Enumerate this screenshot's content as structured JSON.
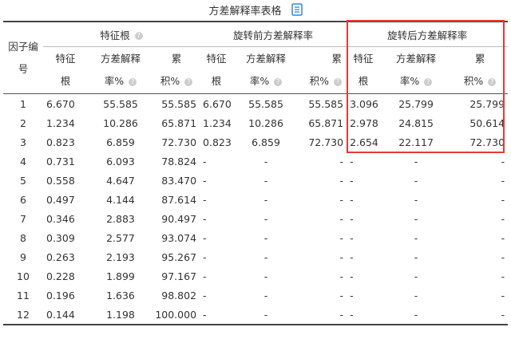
{
  "title": "方差解释率表格",
  "icons": {
    "doc": "document-icon",
    "help": "question-circle-icon"
  },
  "colors": {
    "highlight": "#e53935",
    "icon_blue": "#2e86de"
  },
  "headers": {
    "index": "因子编号",
    "group1": "特征根",
    "group2": "旋转前方差解释率",
    "group3": "旋转后方差解释率",
    "sub_eigen": "特征根",
    "sub_var": "方差解释率%",
    "sub_cum": "累积%"
  },
  "rows": [
    {
      "id": "1",
      "e1": "6.670",
      "v1": "55.585",
      "c1": "55.585",
      "e2": "6.670",
      "v2": "55.585",
      "c2": "55.585",
      "e3": "3.096",
      "v3": "25.799",
      "c3": "25.799"
    },
    {
      "id": "2",
      "e1": "1.234",
      "v1": "10.286",
      "c1": "65.871",
      "e2": "1.234",
      "v2": "10.286",
      "c2": "65.871",
      "e3": "2.978",
      "v3": "24.815",
      "c3": "50.614"
    },
    {
      "id": "3",
      "e1": "0.823",
      "v1": "6.859",
      "c1": "72.730",
      "e2": "0.823",
      "v2": "6.859",
      "c2": "72.730",
      "e3": "2.654",
      "v3": "22.117",
      "c3": "72.730"
    },
    {
      "id": "4",
      "e1": "0.731",
      "v1": "6.093",
      "c1": "78.824",
      "e2": "-",
      "v2": "-",
      "c2": "-",
      "e3": "-",
      "v3": "-",
      "c3": "-"
    },
    {
      "id": "5",
      "e1": "0.558",
      "v1": "4.647",
      "c1": "83.470",
      "e2": "-",
      "v2": "-",
      "c2": "-",
      "e3": "-",
      "v3": "-",
      "c3": "-"
    },
    {
      "id": "6",
      "e1": "0.497",
      "v1": "4.144",
      "c1": "87.614",
      "e2": "-",
      "v2": "-",
      "c2": "-",
      "e3": "-",
      "v3": "-",
      "c3": "-"
    },
    {
      "id": "7",
      "e1": "0.346",
      "v1": "2.883",
      "c1": "90.497",
      "e2": "-",
      "v2": "-",
      "c2": "-",
      "e3": "-",
      "v3": "-",
      "c3": "-"
    },
    {
      "id": "8",
      "e1": "0.309",
      "v1": "2.577",
      "c1": "93.074",
      "e2": "-",
      "v2": "-",
      "c2": "-",
      "e3": "-",
      "v3": "-",
      "c3": "-"
    },
    {
      "id": "9",
      "e1": "0.263",
      "v1": "2.193",
      "c1": "95.267",
      "e2": "-",
      "v2": "-",
      "c2": "-",
      "e3": "-",
      "v3": "-",
      "c3": "-"
    },
    {
      "id": "10",
      "e1": "0.228",
      "v1": "1.899",
      "c1": "97.167",
      "e2": "-",
      "v2": "-",
      "c2": "-",
      "e3": "-",
      "v3": "-",
      "c3": "-"
    },
    {
      "id": "11",
      "e1": "0.196",
      "v1": "1.636",
      "c1": "98.802",
      "e2": "-",
      "v2": "-",
      "c2": "-",
      "e3": "-",
      "v3": "-",
      "c3": "-"
    },
    {
      "id": "12",
      "e1": "0.144",
      "v1": "1.198",
      "c1": "100.000",
      "e2": "-",
      "v2": "-",
      "c2": "-",
      "e3": "-",
      "v3": "-",
      "c3": "-"
    }
  ]
}
